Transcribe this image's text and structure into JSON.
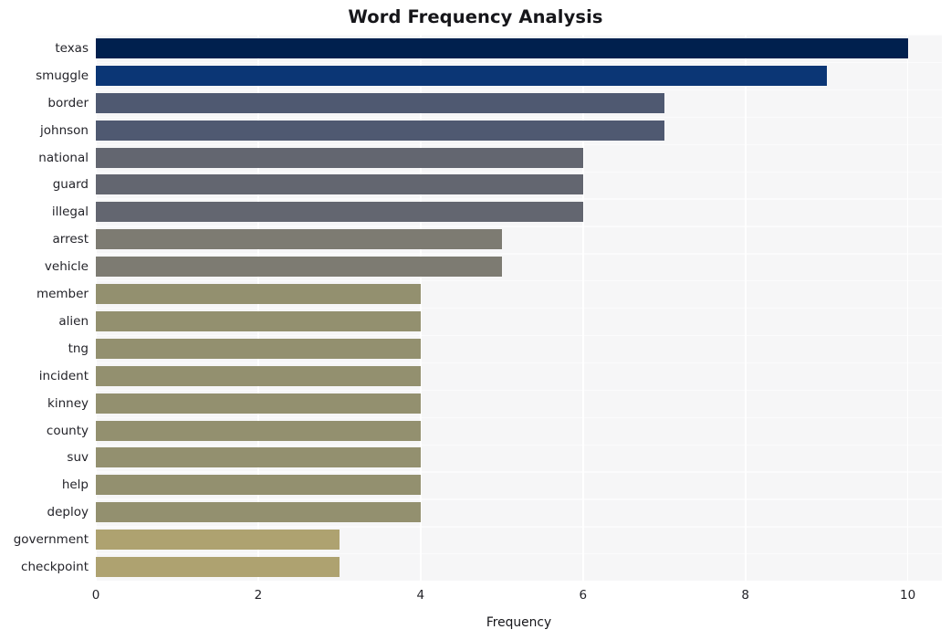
{
  "chart_data": {
    "type": "bar",
    "orientation": "horizontal",
    "title": "Word Frequency Analysis",
    "xlabel": "Frequency",
    "ylabel": "",
    "categories": [
      "texas",
      "smuggle",
      "border",
      "johnson",
      "national",
      "guard",
      "illegal",
      "arrest",
      "vehicle",
      "member",
      "alien",
      "tng",
      "incident",
      "kinney",
      "county",
      "suv",
      "help",
      "deploy",
      "government",
      "checkpoint"
    ],
    "values": [
      10,
      9,
      7,
      7,
      6,
      6,
      6,
      5,
      5,
      4,
      4,
      4,
      4,
      4,
      4,
      4,
      4,
      4,
      3,
      3
    ],
    "bar_colors": [
      "#00204e",
      "#0b3675",
      "#4f5971",
      "#4f5971",
      "#636670",
      "#636670",
      "#636670",
      "#7d7b72",
      "#7d7b72",
      "#93906f",
      "#93906f",
      "#93906f",
      "#93906f",
      "#93906f",
      "#93906f",
      "#93906f",
      "#93906f",
      "#93906f",
      "#aea270",
      "#aea270"
    ],
    "xlim": [
      0,
      10.42
    ],
    "xticks": [
      0,
      2,
      4,
      6,
      8,
      10
    ],
    "xtick_labels": [
      "0",
      "2",
      "4",
      "6",
      "8",
      "10"
    ],
    "grid": true,
    "grid_color": "#ffffff",
    "plot_background": "#f6f6f7",
    "figure_background": "#ffffff",
    "legend": null
  }
}
